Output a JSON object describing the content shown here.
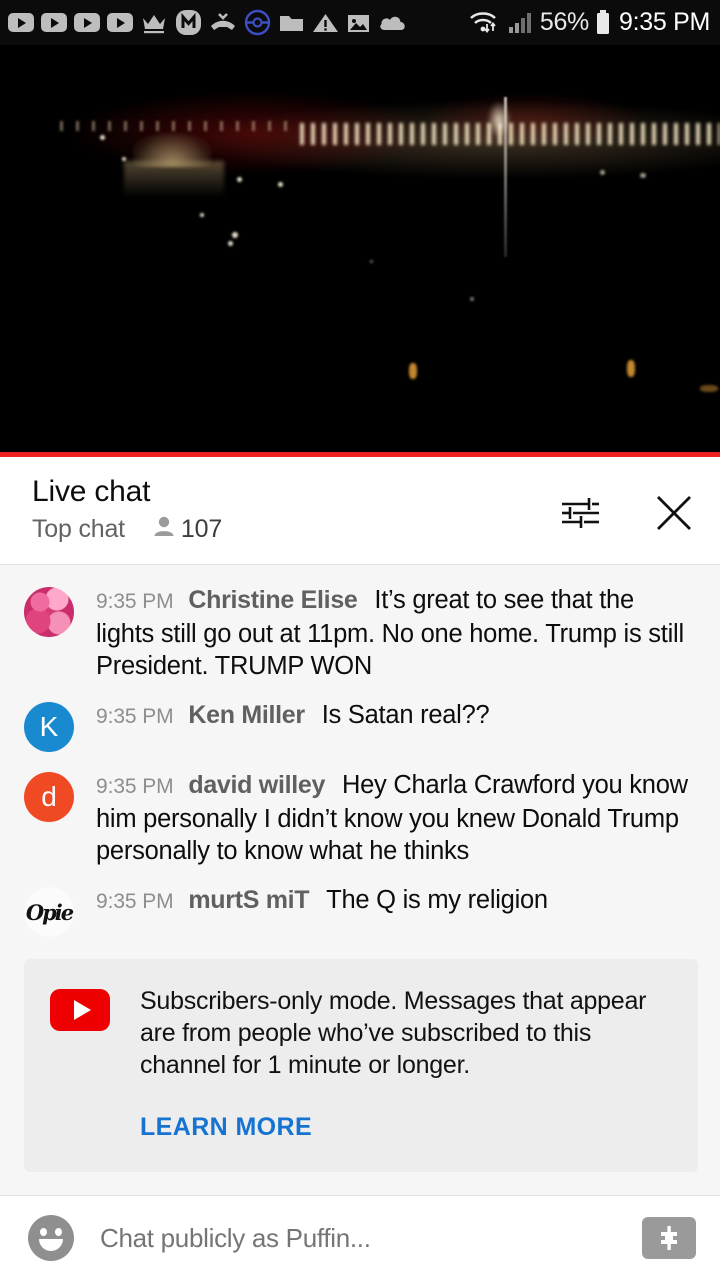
{
  "status_bar": {
    "icons": [
      {
        "name": "youtube-notification-icon-1",
        "glyph": "yt"
      },
      {
        "name": "youtube-notification-icon-2",
        "glyph": "yt"
      },
      {
        "name": "youtube-notification-icon-3",
        "glyph": "yt"
      },
      {
        "name": "youtube-notification-icon-4",
        "glyph": "yt"
      },
      {
        "name": "crown-icon",
        "glyph": "crown"
      },
      {
        "name": "messenger-m-icon",
        "glyph": "m-circle"
      },
      {
        "name": "missed-call-icon",
        "glyph": "missed-call"
      },
      {
        "name": "pokeball-icon",
        "glyph": "pokeball"
      },
      {
        "name": "folder-icon",
        "glyph": "folder"
      },
      {
        "name": "warning-triangle-icon",
        "glyph": "warning"
      },
      {
        "name": "image-icon",
        "glyph": "image"
      },
      {
        "name": "cloud-icon",
        "glyph": "cloud"
      }
    ],
    "wifi_icon": "wifi-transfer-icon",
    "signal_icon": "cellular-signal-icon",
    "battery_percent": "56%",
    "battery_icon": "battery-icon",
    "clock": "9:35 PM"
  },
  "video": {
    "name": "live-video-player",
    "scene": "night-city-skyline",
    "progress_color": "#ef2020"
  },
  "chat_header": {
    "title": "Live chat",
    "mode": "Top chat",
    "viewer_count": "107",
    "filter_icon": "tune-filter-icon",
    "close_icon": "close-icon"
  },
  "messages": [
    {
      "time": "9:35 PM",
      "author": "Christine Elise",
      "text": "It’s great to see that the lights still go out at 11pm. No one home. Trump is still President. TRUMP WON",
      "avatar_type": "image",
      "avatar_style": "roses",
      "avatar_letter": "",
      "avatar_color": "#c92d6b"
    },
    {
      "time": "9:35 PM",
      "author": "Ken Miller",
      "text": "Is Satan real??",
      "avatar_type": "letter",
      "avatar_style": "letter",
      "avatar_letter": "K",
      "avatar_color": "#1a8ad0"
    },
    {
      "time": "9:35 PM",
      "author": "david willey",
      "text": "Hey Charla Crawford you know him personally I didn’t know you knew Donald Trump personally to know what he thinks",
      "avatar_type": "letter",
      "avatar_style": "letter",
      "avatar_letter": "d",
      "avatar_color": "#f04a25"
    },
    {
      "time": "9:35 PM",
      "author": "murtS miT",
      "text": "The Q is my religion",
      "avatar_type": "image",
      "avatar_style": "graffiti",
      "avatar_letter": "Opie",
      "avatar_color": "#fbfbfb"
    }
  ],
  "notice": {
    "icon": "youtube-logo-icon",
    "text": "Subscribers-only mode. Messages that appear are from people who’ve subscribed to this channel for 1 minute or longer.",
    "link_label": "LEARN MORE",
    "link_color": "#1673d1",
    "brand_color": "#ef0000"
  },
  "input_bar": {
    "emoji_icon": "emoji-smiley-icon",
    "placeholder": "Chat publicly as Puffin...",
    "value": "",
    "superchat_icon": "super-chat-dollar-icon"
  }
}
